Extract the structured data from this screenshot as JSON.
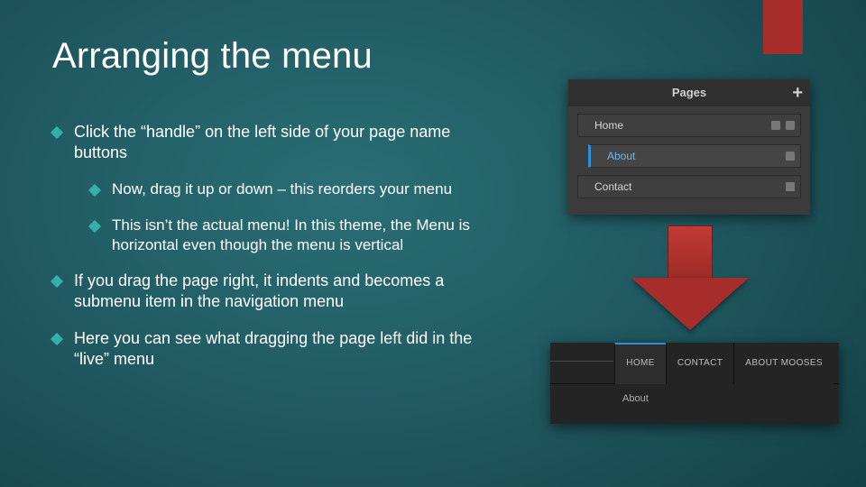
{
  "title": "Arranging the menu",
  "bullets": {
    "b1": "Click the “handle” on the left side of your page name buttons",
    "b1a": "Now, drag it up or down – this reorders your menu",
    "b1b": "This isn’t the actual menu! In this theme, the Menu is horizontal even though the menu is vertical",
    "b2": "If you drag the page right, it indents and becomes a submenu item in the navigation menu",
    "b3": "Here you can see what dragging the page left did in the “live” menu"
  },
  "pages_panel": {
    "header": "Pages",
    "plus": "+",
    "rows": [
      "Home",
      "About",
      "Contact"
    ]
  },
  "live_menu": {
    "tabs": [
      "HOME",
      "CONTACT",
      "ABOUT MOOSES"
    ],
    "submenu": "About"
  }
}
